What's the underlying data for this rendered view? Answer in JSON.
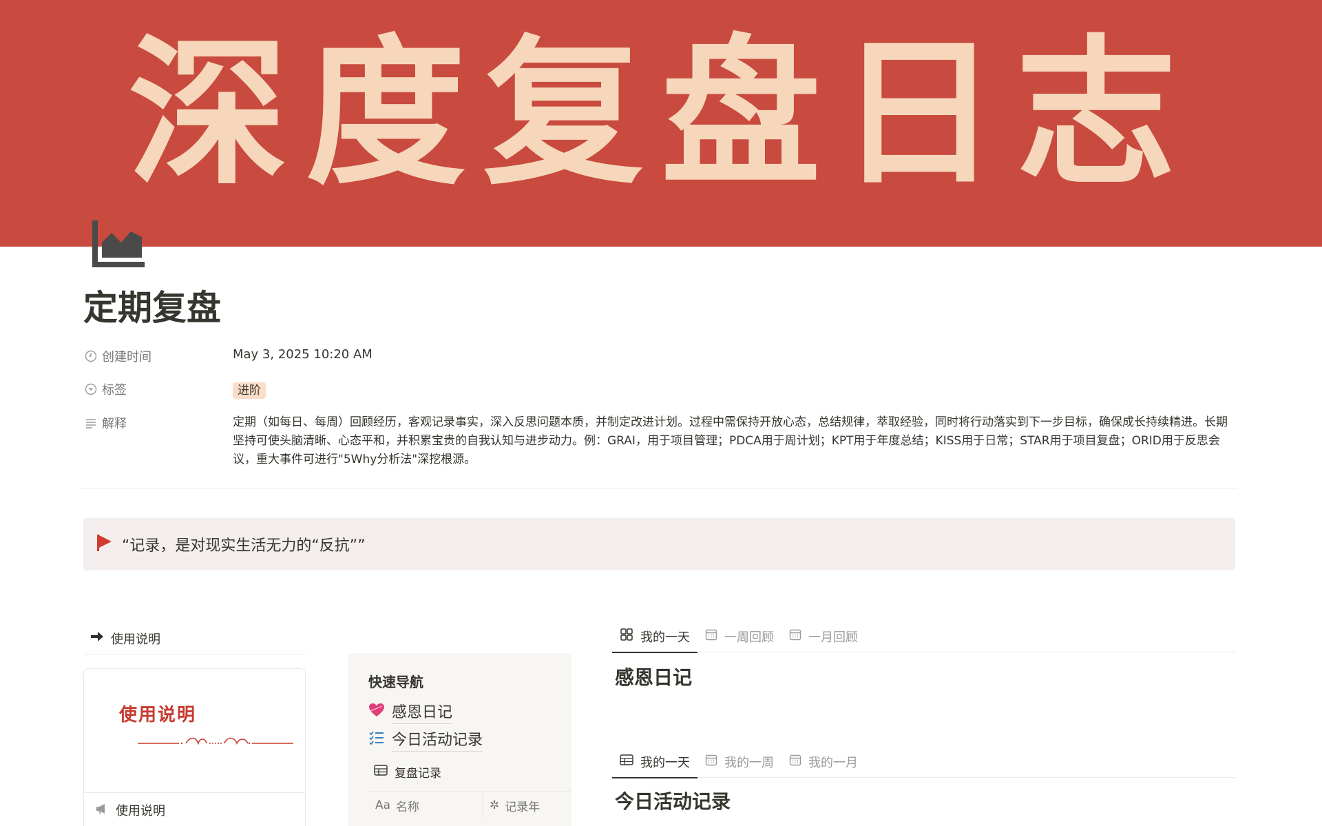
{
  "cover": {
    "title": "深度复盘日志"
  },
  "page": {
    "icon": "area-chart-icon",
    "title": "定期复盘"
  },
  "properties": {
    "created": {
      "label": "创建时间",
      "icon": "clock-icon",
      "value": "May 3, 2025 10:20 AM"
    },
    "tags": {
      "label": "标签",
      "icon": "select-icon",
      "value": "进阶"
    },
    "notes": {
      "label": "解释",
      "icon": "text-lines-icon",
      "value": "定期（如每日、每周）回顾经历，客观记录事实，深入反思问题本质，并制定改进计划。过程中需保持开放心态，总结规律，萃取经验，同时将行动落实到下一步目标，确保成长持续精进。长期坚持可使头脑清晰、心态平和，并积累宝贵的自我认知与进步动力。例：GRAI，用于项目管理；PDCA用于周计划；KPT用于年度总结；KISS用于日常；STAR用于项目复盘；ORID用于反思会议，重大事件可进行\"5Why分析法\"深挖根源。"
    }
  },
  "callout": {
    "icon": "red-flag-icon",
    "text": "“记录，是对现实生活无力的“反抗””"
  },
  "left": {
    "toggle_label": "使用说明",
    "card": {
      "cover_text": "使用说明",
      "caption": "使用说明"
    }
  },
  "nav": {
    "title": "快速导航",
    "links": [
      {
        "icon": "heart-icon",
        "label": "感恩日记"
      },
      {
        "icon": "checklist-icon",
        "label": "今日活动记录"
      }
    ],
    "db_view_label": "复盘记录",
    "db_columns": [
      {
        "icon": "text-property-icon",
        "glyph": "Aa",
        "label": "名称"
      },
      {
        "icon": "gear-property-icon",
        "glyph": "✲",
        "label": "记录年"
      }
    ]
  },
  "tabs1": [
    {
      "label": "我的一天",
      "icon": "gallery-icon",
      "active": true
    },
    {
      "label": "一周回顾",
      "icon": "calendar-icon",
      "active": false
    },
    {
      "label": "一月回顾",
      "icon": "calendar-icon",
      "active": false
    }
  ],
  "section1_title": "感恩日记",
  "tabs2": [
    {
      "label": "我的一天",
      "icon": "table-icon",
      "active": true
    },
    {
      "label": "我的一周",
      "icon": "calendar-icon",
      "active": false
    },
    {
      "label": "我的一月",
      "icon": "calendar-icon",
      "active": false
    }
  ],
  "section2_title": "今日活动记录",
  "colors": {
    "cover_bg": "#c94a3e",
    "cover_text": "#f6d7bb",
    "tag_bg": "#fadec9",
    "callout_bg": "#f4eeee",
    "accent_red": "#c73a2e"
  }
}
